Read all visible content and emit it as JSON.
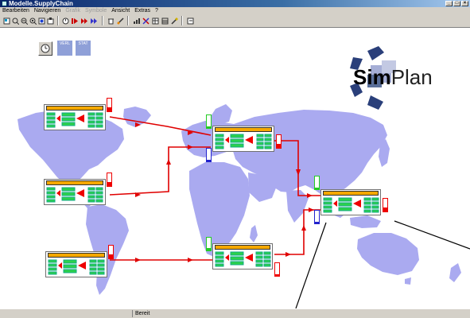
{
  "window": {
    "title": "Modelle.SupplyChain",
    "buttons": {
      "min": "_",
      "max": "□",
      "close": "×"
    }
  },
  "menu": [
    {
      "label": "Bearbeiten",
      "enabled": true
    },
    {
      "label": "Navigieren",
      "enabled": true
    },
    {
      "label": "Grafik",
      "enabled": false
    },
    {
      "label": "Symbole",
      "enabled": false
    },
    {
      "label": "Ansicht",
      "enabled": true
    },
    {
      "label": "Extras",
      "enabled": true
    },
    {
      "label": "?",
      "enabled": true
    }
  ],
  "toolbar": {
    "icons": [
      "page-icon",
      "zoom-in-icon",
      "zoom-out-icon",
      "zoom-fit-icon",
      "pointer-icon",
      "model-icon",
      "timer-icon",
      "play-icon",
      "step-icon",
      "fast-forward-icon",
      "delete-icon",
      "brush-icon",
      "chart-icon",
      "tools-icon",
      "table-icon",
      "settings-icon",
      "info-icon"
    ]
  },
  "canvas": {
    "controls": {
      "clock_icon": "clock-icon",
      "btn1_label": "VERL",
      "btn2_label": "STAT"
    },
    "logo": {
      "sim": "Sim",
      "plan": "Plan",
      "colors": [
        "#2a3f7a",
        "#5a6f9a",
        "#a5aed6",
        "#c3c9e3"
      ]
    }
  },
  "status": {
    "text": "Bereit"
  },
  "colors": {
    "map": "#aaaaf0",
    "route": "#e00000",
    "buffer_bar": "#f5a800",
    "green_box": "#2cd14a"
  }
}
